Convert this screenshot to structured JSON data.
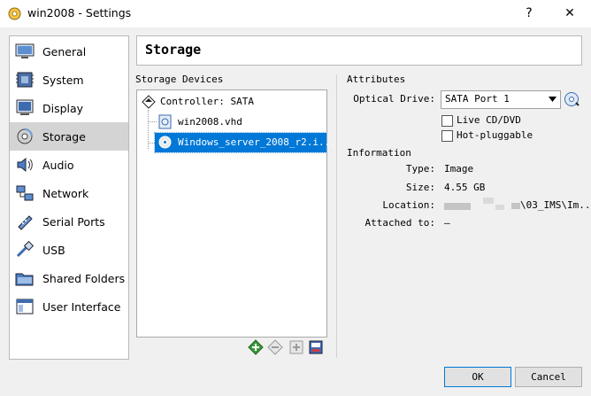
{
  "window": {
    "title": "win2008 - Settings",
    "help": "?",
    "close": "✕"
  },
  "sidebar": {
    "items": [
      {
        "label": "General",
        "icon": "general-icon"
      },
      {
        "label": "System",
        "icon": "system-icon"
      },
      {
        "label": "Display",
        "icon": "display-icon"
      },
      {
        "label": "Storage",
        "icon": "storage-icon",
        "selected": true
      },
      {
        "label": "Audio",
        "icon": "audio-icon"
      },
      {
        "label": "Network",
        "icon": "network-icon"
      },
      {
        "label": "Serial Ports",
        "icon": "serial-ports-icon"
      },
      {
        "label": "USB",
        "icon": "usb-icon"
      },
      {
        "label": "Shared Folders",
        "icon": "shared-folders-icon"
      },
      {
        "label": "User Interface",
        "icon": "user-interface-icon"
      }
    ]
  },
  "page": {
    "title": "Storage"
  },
  "storage_devices": {
    "label": "Storage Devices",
    "controller": "Controller: SATA",
    "items": [
      "win2008.vhd",
      "Windows_server_2008_r2.i..."
    ]
  },
  "attributes": {
    "label": "Attributes",
    "optical_drive_label": "Optical Drive:",
    "optical_drive_value": "SATA Port 1",
    "live_cd_label": "Live CD/DVD",
    "hot_pluggable_label": "Hot-pluggable"
  },
  "information": {
    "label": "Information",
    "type_label": "Type:",
    "type_value": "Image",
    "size_label": "Size:",
    "size_value": "4.55 GB",
    "location_label": "Location:",
    "location_value": "\\03_IMS\\Im...",
    "attached_label": "Attached to:",
    "attached_value": "—"
  },
  "buttons": {
    "ok": "OK",
    "cancel": "Cancel"
  },
  "colors": {
    "selection": "#0078d7",
    "nav_selected": "#d4d4d4"
  }
}
